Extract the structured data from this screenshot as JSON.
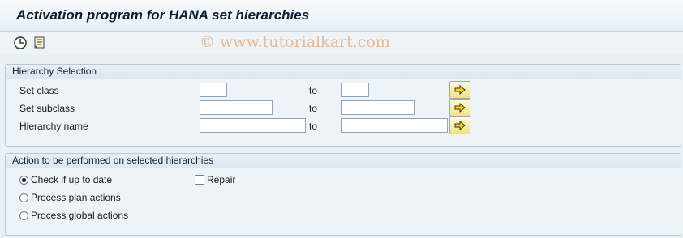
{
  "window": {
    "title": "Activation program for HANA set hierarchies",
    "watermark": "© www.tutorialkart.com"
  },
  "toolbar": {
    "items": [
      {
        "icon": "execute-clock-icon"
      },
      {
        "icon": "get-variant-icon"
      }
    ]
  },
  "hierarchy_selection": {
    "header": "Hierarchy Selection",
    "rows": [
      {
        "label": "Set class",
        "from_value": "",
        "to_label": "to",
        "to_value": ""
      },
      {
        "label": "Set subclass",
        "from_value": "",
        "to_label": "to",
        "to_value": ""
      },
      {
        "label": "Hierarchy name",
        "from_value": "",
        "to_label": "to",
        "to_value": ""
      }
    ],
    "multiple_selection_icon": "arrow-right-icon"
  },
  "actions": {
    "header": "Action to be performed on selected hierarchies",
    "options": [
      {
        "label": "Check if up to date",
        "selected": true
      },
      {
        "label": "Process plan actions",
        "selected": false
      },
      {
        "label": "Process global actions",
        "selected": false
      }
    ],
    "repair": {
      "label": "Repair",
      "checked": false
    }
  },
  "colors": {
    "title_text": "#0a1e33",
    "group_border": "#b8c8d6",
    "multi_button": "#f1e27a",
    "watermark": "#e7b48a"
  }
}
